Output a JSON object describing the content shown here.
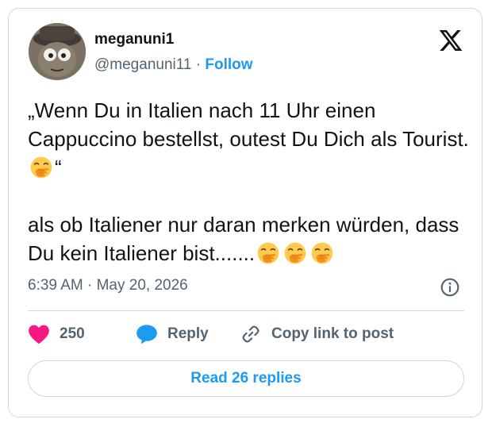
{
  "author": {
    "name": "meganuni1",
    "handle": "@meganuni11",
    "separator": " · ",
    "follow_label": "Follow"
  },
  "tweet": {
    "line1": "„Wenn Du in Italien nach 11 Uhr einen Cappuccino bestellst, outest Du Dich als Tourist.",
    "line1_end": "“",
    "line2": "als ob Italiener nur daran merken würden, dass Du kein Italiener bist.......",
    "emoji_icon": "face-with-hand-over-mouth-icon"
  },
  "meta": {
    "time": "6:39 AM",
    "separator": " · ",
    "date": "May 20, 2026"
  },
  "actions": {
    "like_count": "250",
    "reply_label": "Reply",
    "copy_label": "Copy link to post"
  },
  "read_replies_label": "Read 26 replies",
  "colors": {
    "accent": "#1d9bf0",
    "like": "#f91880",
    "muted": "#536471",
    "border": "#cfd9de"
  }
}
